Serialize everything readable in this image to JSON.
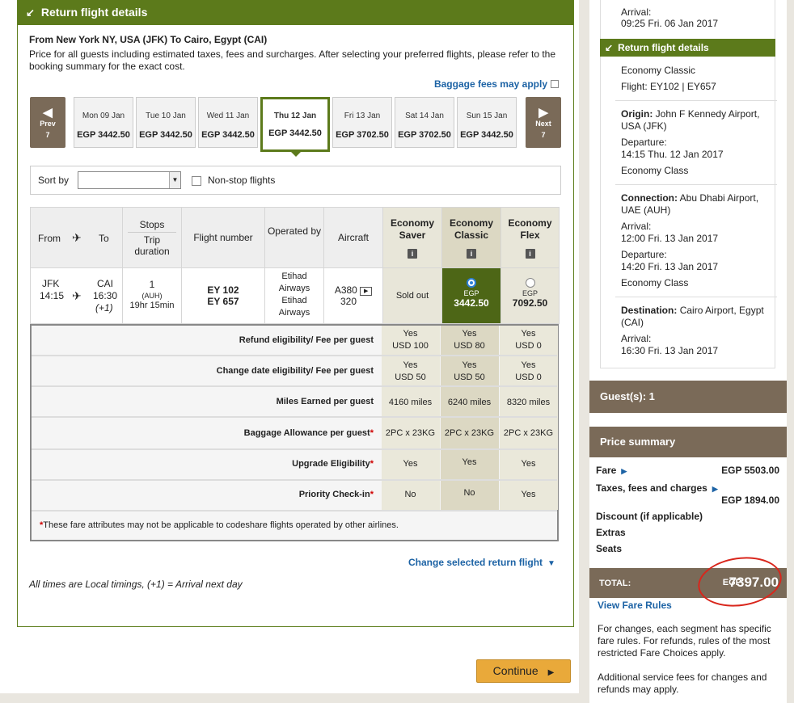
{
  "panel": {
    "title": "Return flight details",
    "route": "From New York NY, USA (JFK) To Cairo, Egypt (CAI)",
    "price_note": "Price for all guests including estimated taxes, fees and surcharges. After selecting your preferred flights, please refer to the booking summary for the exact cost.",
    "baggage_link": "Baggage fees may apply"
  },
  "date_nav": {
    "prev": {
      "label": "Prev",
      "count": "7"
    },
    "next": {
      "label": "Next",
      "count": "7"
    },
    "days": [
      {
        "date": "Mon 09 Jan",
        "price": "EGP 3442.50",
        "selected": false
      },
      {
        "date": "Tue 10 Jan",
        "price": "EGP 3442.50",
        "selected": false
      },
      {
        "date": "Wed 11 Jan",
        "price": "EGP 3442.50",
        "selected": false
      },
      {
        "date": "Thu 12 Jan",
        "price": "EGP 3442.50",
        "selected": true
      },
      {
        "date": "Fri 13 Jan",
        "price": "EGP 3702.50",
        "selected": false
      },
      {
        "date": "Sat 14 Jan",
        "price": "EGP 3702.50",
        "selected": false
      },
      {
        "date": "Sun 15 Jan",
        "price": "EGP 3442.50",
        "selected": false
      }
    ]
  },
  "sort": {
    "label": "Sort by",
    "value": "",
    "nonstop_label": "Non-stop flights"
  },
  "table": {
    "headers": {
      "from": "From",
      "to": "To",
      "stops": "Stops",
      "trip_duration": "Trip duration",
      "flight_number": "Flight number",
      "operated_by": "Operated by",
      "aircraft": "Aircraft",
      "fare_saver": "Economy Saver",
      "fare_classic": "Economy Classic",
      "fare_flex": "Economy Flex"
    },
    "row": {
      "from_code": "JFK",
      "from_time": "14:15",
      "to_code": "CAI",
      "to_time": "16:30",
      "to_offset": "(+1)",
      "stops": "1",
      "stop_code": "(AUH)",
      "duration": "19hr 15min",
      "flight1": "EY 102",
      "flight2": "EY 657",
      "operator1a": "Etihad",
      "operator1b": "Airways",
      "operator2a": "Etihad",
      "operator2b": "Airways",
      "aircraft1": "A380",
      "aircraft2": "320",
      "saver": "Sold out",
      "classic_cur": "EGP",
      "classic_price": "3442.50",
      "flex_cur": "EGP",
      "flex_price": "7092.50"
    },
    "attributes": [
      {
        "label": "Refund eligibility/ Fee per guest",
        "star": false,
        "saver": [
          "Yes",
          "USD 100"
        ],
        "classic": [
          "Yes",
          "USD 80"
        ],
        "flex": [
          "Yes",
          "USD 0"
        ]
      },
      {
        "label": "Change date eligibility/ Fee per guest",
        "star": false,
        "saver": [
          "Yes",
          "USD 50"
        ],
        "classic": [
          "Yes",
          "USD 50"
        ],
        "flex": [
          "Yes",
          "USD 0"
        ]
      },
      {
        "label": "Miles Earned per guest",
        "star": false,
        "saver": [
          "4160 miles"
        ],
        "classic": [
          "6240 miles"
        ],
        "flex": [
          "8320 miles"
        ]
      },
      {
        "label": "Baggage Allowance per guest",
        "star": true,
        "saver": [
          "2PC x 23KG"
        ],
        "classic": [
          "2PC x 23KG"
        ],
        "flex": [
          "2PC x 23KG"
        ]
      },
      {
        "label": "Upgrade Eligibility",
        "star": true,
        "saver": [
          "Yes"
        ],
        "classic": [
          "Yes"
        ],
        "flex": [
          "Yes"
        ]
      },
      {
        "label": "Priority Check-in",
        "star": true,
        "saver": [
          "No"
        ],
        "classic": [
          "No"
        ],
        "flex": [
          "Yes"
        ]
      }
    ],
    "footnote_star": "*",
    "footnote": "These fare attributes may not be applicable to codeshare flights operated by other airlines."
  },
  "change_link": "Change selected return flight",
  "times_note": "All times are Local timings, (+1) = Arrival next day",
  "continue_label": "Continue",
  "sidebar": {
    "top_arrival_label": "Arrival:",
    "top_arrival_value": "09:25 Fri. 06 Jan 2017",
    "return_header": "Return flight details",
    "cabin": "Economy Classic",
    "flight": "Flight: EY102 | EY657",
    "origin_label": "Origin:",
    "origin_value": "John F Kennedy Airport, USA (JFK)",
    "departure_label": "Departure:",
    "departure_value": "14:15 Thu. 12 Jan 2017",
    "origin_class": "Economy Class",
    "connection_label": "Connection:",
    "connection_value": "Abu Dhabi Airport, UAE (AUH)",
    "conn_arrival_label": "Arrival:",
    "conn_arrival_value": "12:00 Fri. 13 Jan 2017",
    "conn_departure_label": "Departure:",
    "conn_departure_value": "14:20 Fri. 13 Jan 2017",
    "conn_class": "Economy Class",
    "destination_label": "Destination:",
    "destination_value": "Cairo Airport, Egypt (CAI)",
    "dest_arrival_label": "Arrival:",
    "dest_arrival_value": "16:30 Fri. 13 Jan 2017",
    "guests": "Guest(s): 1",
    "price_summary": "Price summary",
    "fare_label": "Fare",
    "fare_value": "EGP 5503.00",
    "taxes_label": "Taxes, fees and charges",
    "taxes_value": "EGP 1894.00",
    "discount_label": "Discount (if applicable)",
    "extras_label": "Extras",
    "seats_label": "Seats",
    "total_label": "TOTAL:",
    "total_currency": "EGP",
    "total_value": "7397.00",
    "fare_rules_link": "View Fare Rules",
    "note1": "For changes, each segment has specific fare rules. For refunds, rules of the most restricted Fare Choices apply.",
    "note2": "Additional service fees for changes and refunds may apply."
  },
  "colors": {
    "brand_green": "#5c7a1b",
    "brown": "#7a6a58",
    "link_blue": "#1d63a5",
    "continue_orange": "#e9a93a",
    "annotation_red": "#d9261c"
  }
}
